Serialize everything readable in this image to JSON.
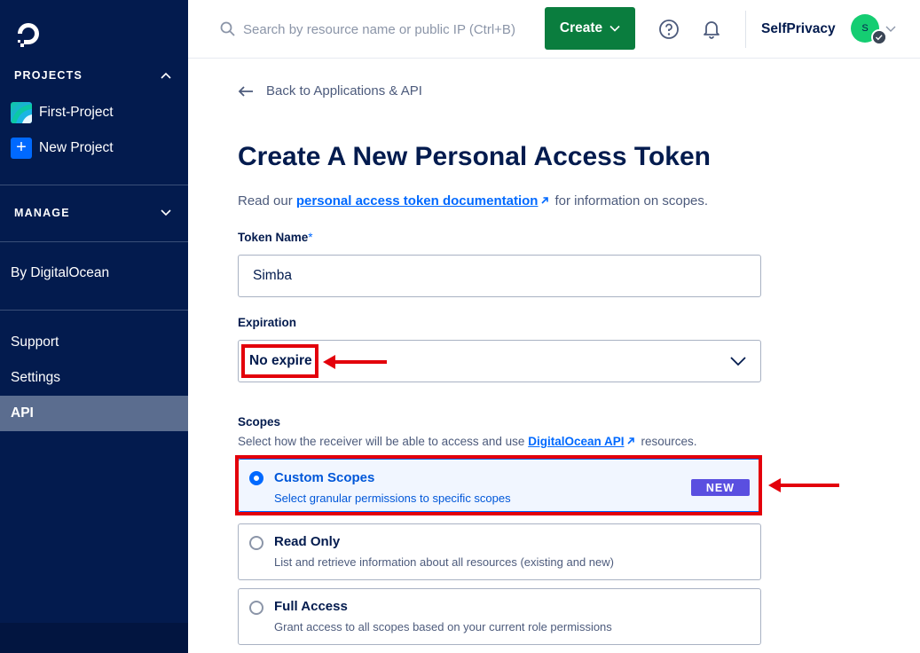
{
  "sidebar": {
    "projects_header": "PROJECTS",
    "projects": [
      {
        "label": "First-Project"
      },
      {
        "label": "New Project",
        "icon": "+"
      }
    ],
    "manage_header": "MANAGE",
    "by_do": "By DigitalOcean",
    "nav": [
      {
        "label": "Support"
      },
      {
        "label": "Settings"
      },
      {
        "label": "API",
        "active": true
      }
    ]
  },
  "topbar": {
    "search_placeholder": "Search by resource name or public IP (Ctrl+B)",
    "create_label": "Create",
    "team_name": "SelfPrivacy",
    "avatar_initial": "S"
  },
  "main": {
    "back_label": "Back to Applications & API",
    "title": "Create A New Personal Access Token",
    "intro_prefix": "Read our",
    "intro_link": "personal access token documentation",
    "intro_suffix": "for information on scopes.",
    "token_name_label": "Token Name",
    "token_name_required": "*",
    "token_name_value": "Simba",
    "expiration_label": "Expiration",
    "expiration_value": "No expire",
    "scopes_label": "Scopes",
    "scopes_desc_prefix": "Select how the receiver will be able to access and use",
    "scopes_desc_link": "DigitalOcean API",
    "scopes_desc_suffix": "resources.",
    "scope_options": [
      {
        "title": "Custom Scopes",
        "subtitle": "Select granular permissions to specific scopes",
        "badge": "NEW",
        "selected": true
      },
      {
        "title": "Read Only",
        "subtitle": "List and retrieve information about all resources (existing and new)",
        "selected": false
      },
      {
        "title": "Full Access",
        "subtitle": "Grant access to all scopes based on your current role permissions",
        "selected": false
      }
    ]
  },
  "colors": {
    "sidebar_bg": "#031b4e",
    "primary_blue": "#0069ff",
    "create_green": "#0a7d3e",
    "annotation_red": "#e3000b",
    "badge_purple": "#5a4fe0"
  }
}
